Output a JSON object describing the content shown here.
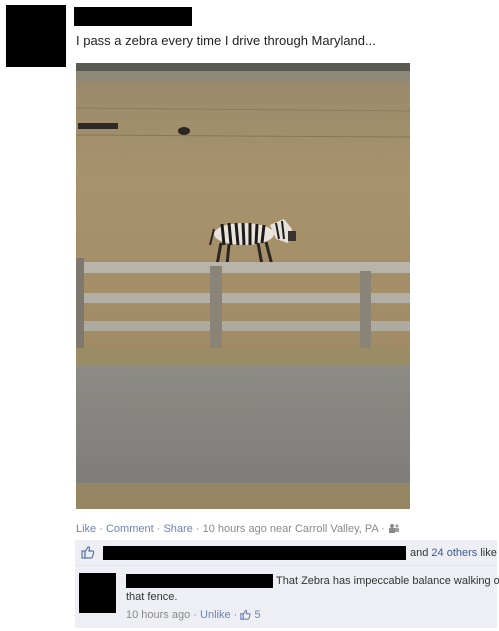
{
  "post": {
    "text": "I pass a zebra every time I drive through Maryland..."
  },
  "actions": {
    "like": "Like",
    "comment": "Comment",
    "share": "Share",
    "separator": "·",
    "meta": "10 hours ago near Carroll Valley, PA",
    "audience_icon": "friends-icon"
  },
  "likes": {
    "suffix_prefix": "and",
    "others": "24 others",
    "suffix": "like this.",
    "icon": "thumbs-up-icon"
  },
  "comment": {
    "line1": "That Zebra has impeccable balance walking on",
    "line2": "that fence.",
    "time": "10 hours ago",
    "unlike": "Unlike",
    "like_count": "5"
  },
  "colors": {
    "link": "#6d84b4",
    "link_dark": "#3b5998",
    "meta_gray": "#8a8a8a",
    "box_bg": "#edeff4"
  }
}
